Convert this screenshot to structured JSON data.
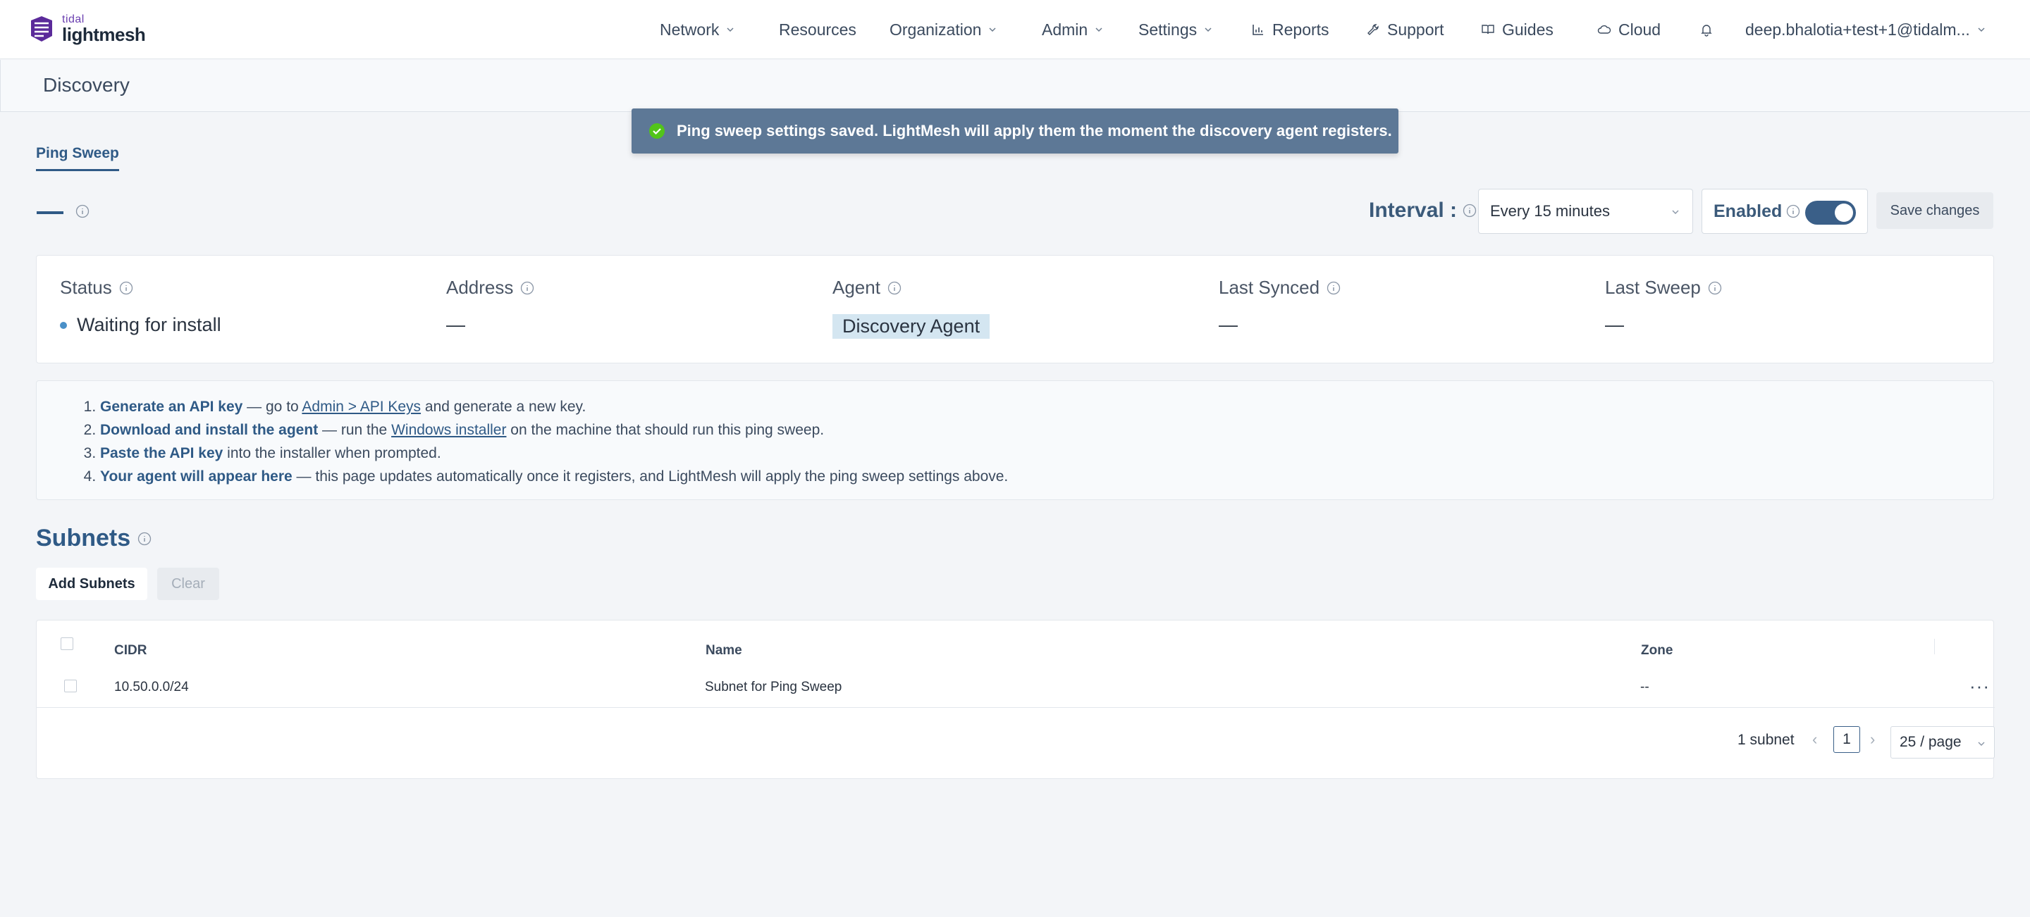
{
  "nav": {
    "logo_small": "tidal",
    "logo_big": "lightmesh",
    "items": [
      {
        "label": "Network",
        "has_dropdown": true
      },
      {
        "label": "Resources",
        "has_dropdown": false
      },
      {
        "label": "Organization",
        "has_dropdown": true
      },
      {
        "label": "Admin",
        "has_dropdown": true
      },
      {
        "label": "Settings",
        "has_dropdown": true
      },
      {
        "label": "Reports",
        "icon": "bar-chart-icon"
      },
      {
        "label": "Support",
        "icon": "wrench-icon"
      },
      {
        "label": "Guides",
        "icon": "book-icon"
      },
      {
        "label": "Cloud",
        "icon": "cloud-icon"
      }
    ],
    "user": "deep.bhalotia+test+1@tidalm..."
  },
  "page": {
    "title": "Discovery"
  },
  "toast": {
    "message": "Ping sweep settings saved. LightMesh will apply them the moment the discovery agent registers."
  },
  "tabs": {
    "active": "Ping Sweep"
  },
  "controls": {
    "name_value": "—",
    "interval_label": "Interval :",
    "interval_value": "Every 15 minutes",
    "enabled_label": "Enabled",
    "enabled_state": true,
    "save_label": "Save changes"
  },
  "status": {
    "status_label": "Status",
    "status_value": "Waiting for install",
    "address_label": "Address",
    "address_value": "—",
    "agent_label": "Agent",
    "agent_value": "Discovery Agent",
    "last_synced_label": "Last Synced",
    "last_synced_value": "—",
    "last_sweep_label": "Last Sweep",
    "last_sweep_value": "—"
  },
  "steps": [
    {
      "bold": "Generate an API key",
      "pre": " — go to ",
      "link": "Admin > API Keys",
      "post": " and generate a new key."
    },
    {
      "bold": "Download and install the agent",
      "pre": " — run the ",
      "link": "Windows installer",
      "post": " on the machine that should run this ping sweep."
    },
    {
      "bold": "Paste the API key",
      "pre": " into the installer when prompted.",
      "link": "",
      "post": ""
    },
    {
      "bold": "Your agent will appear here",
      "pre": " — this page updates automatically once it registers, and LightMesh will apply the ping sweep settings above.",
      "link": "",
      "post": ""
    }
  ],
  "subnets": {
    "title": "Subnets",
    "add_label": "Add Subnets",
    "clear_label": "Clear",
    "columns": [
      "CIDR",
      "Name",
      "Zone"
    ],
    "rows": [
      {
        "cidr": "10.50.0.0/24",
        "name": "Subnet for Ping Sweep",
        "zone": "--"
      }
    ],
    "count_label": "1 subnet",
    "current_page": "1",
    "page_size": "25 / page"
  },
  "colors": {
    "accent": "#2f5a86",
    "toast_bg": "#5d7896",
    "toggle_on": "#3a5f88",
    "success": "#52c41a"
  }
}
